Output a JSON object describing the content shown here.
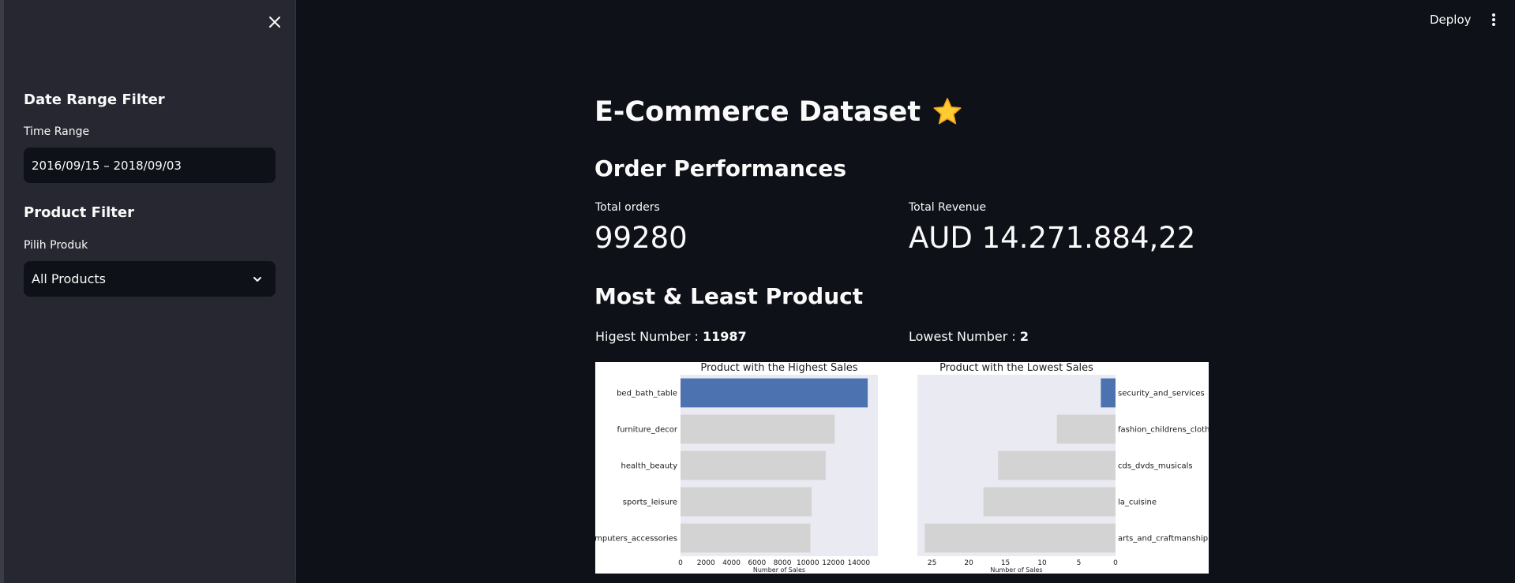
{
  "sidebar": {
    "date_filter_heading": "Date Range Filter",
    "time_range_label": "Time Range",
    "time_range_value": "2016/09/15 – 2018/09/03",
    "product_filter_heading": "Product Filter",
    "product_select_label": "Pilih Produk",
    "product_select_value": "All Products"
  },
  "header": {
    "deploy_label": "Deploy"
  },
  "main": {
    "title": "E-Commerce Dataset",
    "title_emoji": "⭐",
    "section_order": "Order Performances",
    "total_orders_label": "Total orders",
    "total_orders_value": "99280",
    "total_revenue_label": "Total Revenue",
    "total_revenue_value": "AUD 14.271.884,22",
    "section_products": "Most & Least Product",
    "highest_label": "Higest Number : ",
    "highest_value": "11987",
    "lowest_label": "Lowest Number : ",
    "lowest_value": "2"
  },
  "colors": {
    "highlight_bar": "#4c72b0",
    "other_bar": "#d3d3d3",
    "plot_background": "#eaeaf2"
  },
  "chart_data": [
    {
      "type": "bar",
      "orientation": "horizontal",
      "title": "Product with the Highest Sales",
      "xlabel": "Number of Sales",
      "ylabel": "",
      "categories": [
        "bed_bath_table",
        "furniture_decor",
        "health_beauty",
        "sports_leisure",
        "computers_accessories"
      ],
      "values": [
        14700,
        12100,
        11400,
        10300,
        10200
      ],
      "xlim": [
        0,
        15500
      ],
      "xticks": [
        0,
        2000,
        4000,
        6000,
        8000,
        10000,
        12000,
        14000
      ],
      "grid": false
    },
    {
      "type": "bar",
      "orientation": "horizontal",
      "x_inverted": true,
      "y_axis_position": "right",
      "title": "Product with the Lowest Sales",
      "xlabel": "Number of Sales",
      "ylabel": "",
      "categories": [
        "security_and_services",
        "fashion_childrens_clothes",
        "cds_dvds_musicals",
        "la_cuisine",
        "arts_and_craftmanship"
      ],
      "values": [
        2,
        8,
        16,
        18,
        26
      ],
      "xlim": [
        27,
        0
      ],
      "xticks": [
        25,
        20,
        15,
        10,
        5,
        0
      ],
      "grid": false
    }
  ]
}
